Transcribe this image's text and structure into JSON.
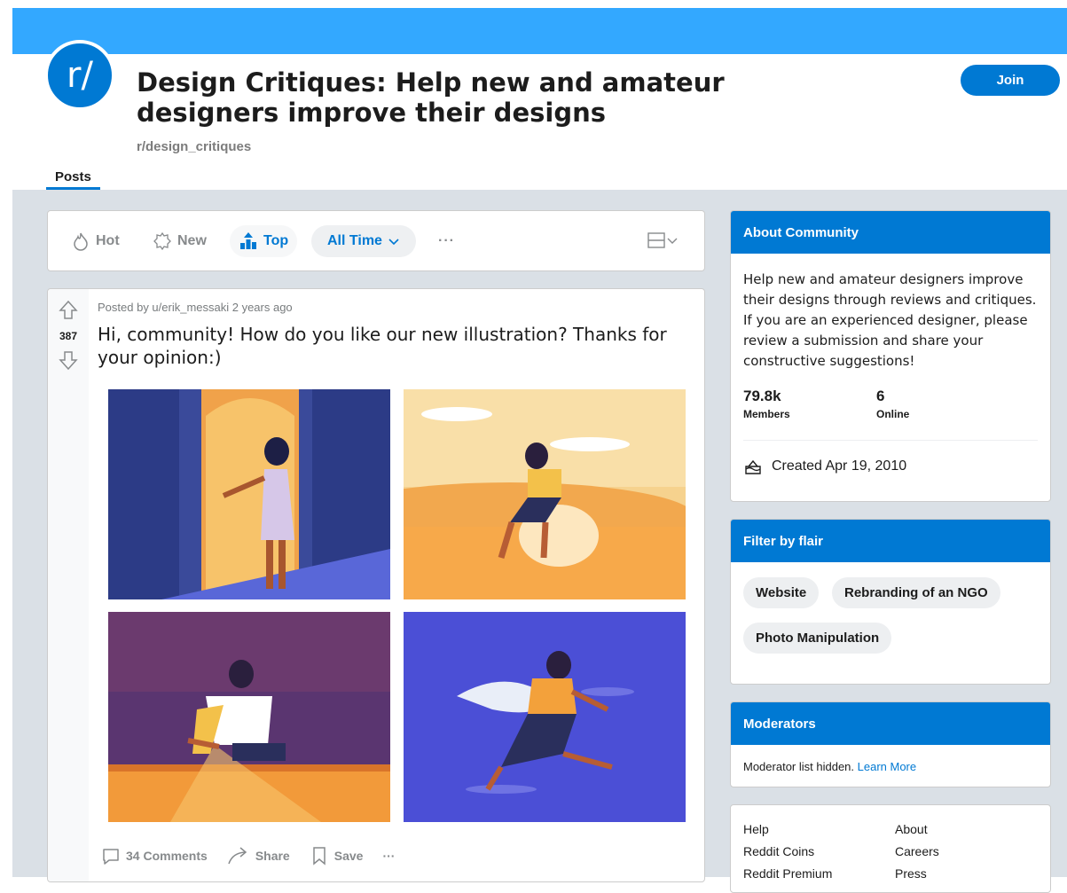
{
  "subreddit": {
    "icon_text": "r/",
    "title": "Design Critiques: Help new and amateur designers improve their designs",
    "name": "r/design_critiques",
    "join_label": "Join",
    "tab_label": "Posts"
  },
  "colors": {
    "banner": "#33a8ff",
    "accent": "#0079d3",
    "background": "#dae0e6"
  },
  "sort": {
    "hot": "Hot",
    "new": "New",
    "top": "Top",
    "time_range": "All Time",
    "more": "···"
  },
  "post": {
    "meta": "Posted by u/erik_messaki 2 years ago",
    "votes": "387",
    "title": "Hi, community! How do you like our new illustration? Thanks for your opinion:)",
    "comments_label": "34 Comments",
    "share_label": "Share",
    "save_label": "Save",
    "more_label": "···"
  },
  "about": {
    "heading": "About Community",
    "description": "Help new and amateur designers improve their designs through reviews and critiques. If you are an experienced designer, please review a submission and share your constructive suggestions!",
    "members_count": "79.8k",
    "members_label": "Members",
    "online_count": "6",
    "online_label": "Online",
    "created": "Created Apr 19, 2010"
  },
  "flair": {
    "heading": "Filter by flair",
    "chips": [
      "Website",
      "Rebranding of an NGO",
      "Photo Manipulation"
    ]
  },
  "moderators": {
    "heading": "Moderators",
    "text": "Moderator list hidden.",
    "link": "Learn More"
  },
  "footer": {
    "links": [
      "Help",
      "About",
      "Reddit Coins",
      "Careers",
      "Reddit Premium",
      "Press"
    ]
  }
}
